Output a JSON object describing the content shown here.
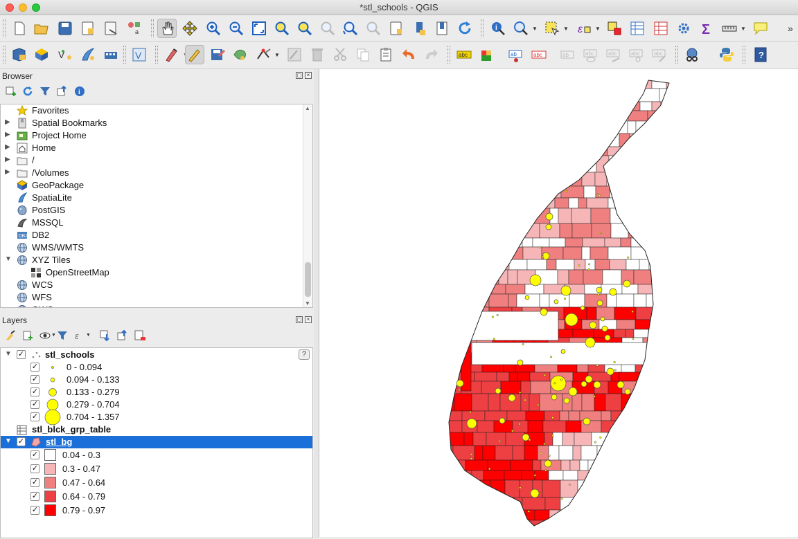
{
  "window": {
    "title": "*stl_schools - QGIS"
  },
  "browser": {
    "title": "Browser",
    "items": [
      {
        "label": "Favorites",
        "icon": "star-icon",
        "arrow": ""
      },
      {
        "label": "Spatial Bookmarks",
        "icon": "bookmark-icon",
        "arrow": "▶"
      },
      {
        "label": "Project Home",
        "icon": "project-home-icon",
        "arrow": "▶"
      },
      {
        "label": "Home",
        "icon": "home-icon",
        "arrow": "▶"
      },
      {
        "label": "/",
        "icon": "folder-icon",
        "arrow": "▶"
      },
      {
        "label": "/Volumes",
        "icon": "folder-icon",
        "arrow": "▶"
      },
      {
        "label": "GeoPackage",
        "icon": "geopackage-icon",
        "arrow": ""
      },
      {
        "label": "SpatiaLite",
        "icon": "spatialite-icon",
        "arrow": ""
      },
      {
        "label": "PostGIS",
        "icon": "postgis-icon",
        "arrow": ""
      },
      {
        "label": "MSSQL",
        "icon": "mssql-icon",
        "arrow": ""
      },
      {
        "label": "DB2",
        "icon": "db2-icon",
        "arrow": ""
      },
      {
        "label": "WMS/WMTS",
        "icon": "globe-icon",
        "arrow": ""
      },
      {
        "label": "XYZ Tiles",
        "icon": "globe-icon",
        "arrow": "▼"
      },
      {
        "label": "OpenStreetMap",
        "icon": "tiles-icon",
        "arrow": ""
      },
      {
        "label": "WCS",
        "icon": "globe-icon",
        "arrow": ""
      },
      {
        "label": "WFS",
        "icon": "globe-icon",
        "arrow": ""
      },
      {
        "label": "OWS",
        "icon": "globe-icon",
        "arrow": ""
      }
    ]
  },
  "layers": {
    "title": "Layers",
    "schools": {
      "name": "stl_schools",
      "classes": [
        "0 - 0.094",
        "0.094 - 0.133",
        "0.133 - 0.279",
        "0.279 - 0.704",
        "0.704 - 1.357"
      ]
    },
    "table": {
      "name": "stl_blck_grp_table"
    },
    "bg": {
      "name": "stl_bg",
      "classes": [
        {
          "label": "0.04 - 0.3",
          "color": "#ffffff"
        },
        {
          "label": "0.3 - 0.47",
          "color": "#f6b6b8"
        },
        {
          "label": "0.47 - 0.64",
          "color": "#f08080"
        },
        {
          "label": "0.64 - 0.79",
          "color": "#ee3f42"
        },
        {
          "label": "0.79 - 0.97",
          "color": "#ff0000"
        }
      ]
    }
  },
  "colors": {
    "point": "#ffff00",
    "selection": "#1a6fd8"
  }
}
